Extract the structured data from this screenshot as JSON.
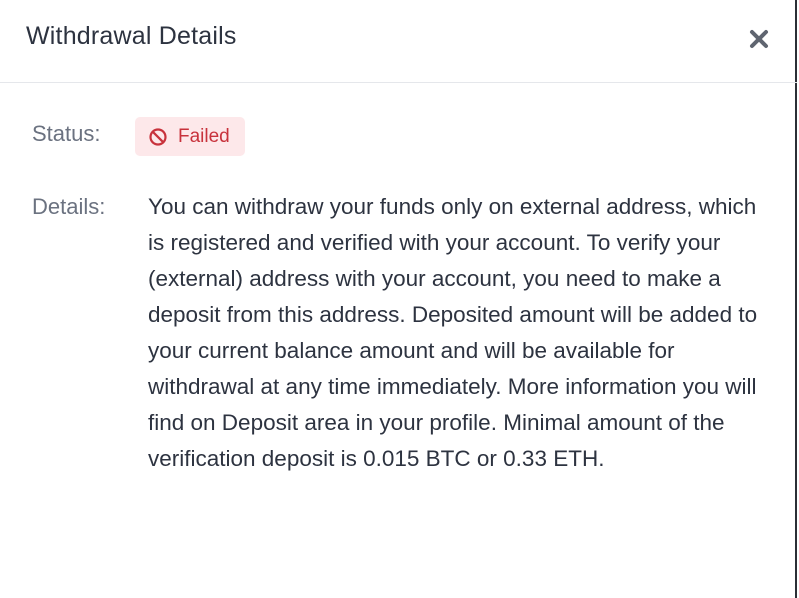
{
  "modal": {
    "title": "Withdrawal Details",
    "close_icon": "close-icon"
  },
  "status": {
    "label": "Status:",
    "badge_text": "Failed",
    "badge_icon": "prohibited-icon",
    "badge_color": "#c8323c",
    "badge_background": "#fde8ea"
  },
  "details": {
    "label": "Details:",
    "text": "You can withdraw your funds only on external address, which is registered and verified with your account. To verify your (external) address with your account, you need to make a deposit from this address. Deposited amount will be added to your current balance amount and will be available for withdrawal at any time immediately. More information you will find on Deposit area in your profile. Minimal amount of the verification deposit is 0.015 BTC or 0.33 ETH."
  }
}
